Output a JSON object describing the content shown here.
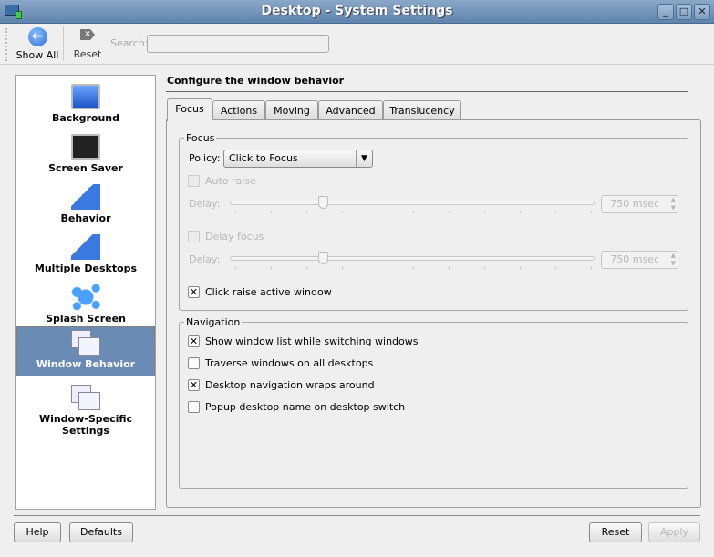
{
  "window": {
    "title": "Desktop - System Settings"
  },
  "toolbar": {
    "show_all": "Show All",
    "reset": "Reset",
    "search_label": "Search:",
    "search_value": ""
  },
  "sidebar": {
    "items": [
      {
        "label": "Background",
        "icon": "background-icon"
      },
      {
        "label": "Screen Saver",
        "icon": "screensaver-icon"
      },
      {
        "label": "Behavior",
        "icon": "behavior-icon"
      },
      {
        "label": "Multiple Desktops",
        "icon": "multiple-desktops-icon"
      },
      {
        "label": "Splash Screen",
        "icon": "splash-icon"
      },
      {
        "label": "Window Behavior",
        "icon": "window-behavior-icon",
        "selected": true
      },
      {
        "label": "Window-Specific Settings",
        "icon": "window-specific-icon"
      }
    ]
  },
  "main": {
    "header": "Configure the window behavior",
    "tabs": [
      "Focus",
      "Actions",
      "Moving",
      "Advanced",
      "Translucency"
    ],
    "focus_group": {
      "title": "Focus",
      "policy_label": "Policy:",
      "policy_value": "Click to Focus",
      "auto_raise": "Auto raise",
      "delay_label": "Delay:",
      "delay_value": "750 msec",
      "delay_focus": "Delay focus",
      "delay_focus_label": "Delay:",
      "delay_focus_value": "750 msec",
      "click_raise": "Click raise active window",
      "click_raise_checked": true
    },
    "nav_group": {
      "title": "Navigation",
      "items": [
        {
          "label": "Show window list while switching windows",
          "checked": true
        },
        {
          "label": "Traverse windows on all desktops",
          "checked": false
        },
        {
          "label": "Desktop navigation wraps around",
          "checked": true
        },
        {
          "label": "Popup desktop name on desktop switch",
          "checked": false
        }
      ]
    }
  },
  "footer": {
    "help": "Help",
    "defaults": "Defaults",
    "reset": "Reset",
    "apply": "Apply"
  },
  "colors": {
    "accent": "#6a8cb4",
    "titlebar": "#6d8fb5"
  }
}
